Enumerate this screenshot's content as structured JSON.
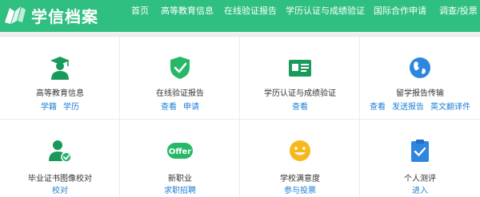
{
  "header": {
    "logo_text": "学信档案",
    "nav": [
      "首页",
      "高等教育信息",
      "在线验证报告",
      "学历认证与成绩验证",
      "国际合作申请",
      "调查/投票"
    ]
  },
  "colors": {
    "brand": "#2fbf81",
    "link": "#1f7fd6"
  },
  "services": [
    {
      "title": "高等教育信息",
      "icon": "graduate-icon",
      "links": [
        "学籍",
        "学历"
      ]
    },
    {
      "title": "在线验证报告",
      "icon": "shield-check-icon",
      "links": [
        "查看",
        "申请"
      ]
    },
    {
      "title": "学历认证与成绩验证",
      "icon": "certificate-card-icon",
      "links": [
        "查看"
      ]
    },
    {
      "title": "留学报告传输",
      "icon": "globe-icon",
      "links": [
        "查看",
        "发送报告",
        "英文翻译件"
      ]
    },
    {
      "title": "毕业证书图像校对",
      "icon": "user-check-icon",
      "links": [
        "校对"
      ]
    },
    {
      "title": "新职业",
      "icon": "offer-badge-icon",
      "links": [
        "求职招聘"
      ]
    },
    {
      "title": "学校满意度",
      "icon": "smiley-icon",
      "links": [
        "参与投票"
      ]
    },
    {
      "title": "个人测评",
      "icon": "clipboard-check-icon",
      "links": [
        "进入"
      ]
    }
  ]
}
